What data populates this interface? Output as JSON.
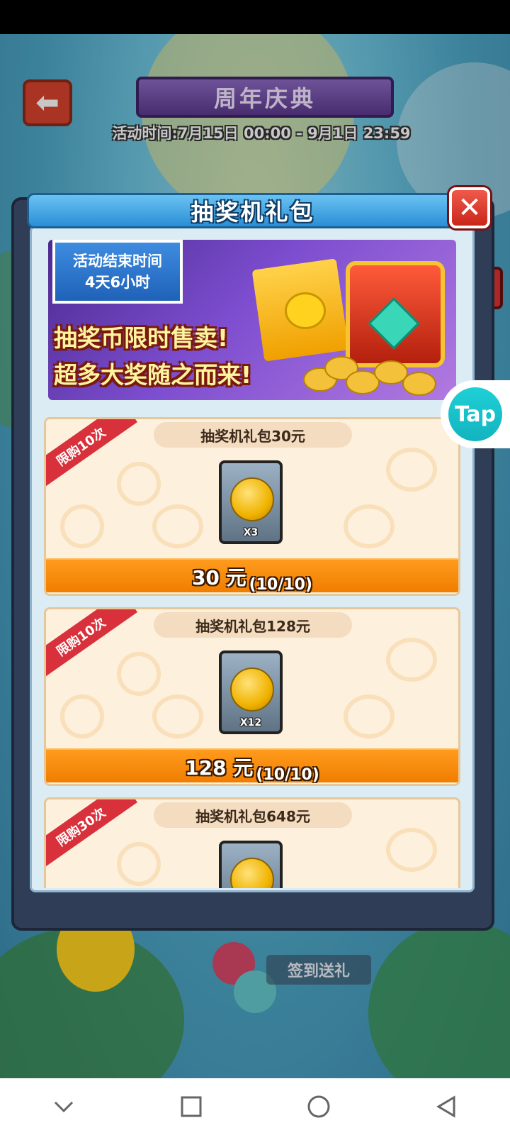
{
  "background": {
    "banner_title": "周年庆典",
    "event_time": "活动时间:7月15日 00:00 - 9月1日 23:59",
    "sign_in_label": "签到送礼",
    "back_icon": "back-arrow-icon"
  },
  "modal": {
    "title": "抽奖机礼包",
    "close_icon": "close-icon"
  },
  "promo": {
    "end_label": "活动结束时间",
    "remaining": "4天6小时",
    "line1": "抽奖币限时售卖!",
    "line2": "超多大奖随之而来!"
  },
  "packages": [
    {
      "limit": "限购10次",
      "title": "抽奖机礼包30元",
      "qty": "X3",
      "price": "30 元",
      "stock": "(10/10)"
    },
    {
      "limit": "限购10次",
      "title": "抽奖机礼包128元",
      "qty": "X12",
      "price": "128 元",
      "stock": "(10/10)"
    },
    {
      "limit": "限购30次",
      "title": "抽奖机礼包648元",
      "qty": "",
      "price": "",
      "stock": ""
    }
  ],
  "overlay": {
    "tap_label": "Tap"
  },
  "navbar": {
    "icons": [
      "chevron-down-icon",
      "recents-square-icon",
      "home-circle-icon",
      "back-triangle-icon"
    ]
  },
  "colors": {
    "header_blue": "#2b8fd6",
    "buy_orange": "#f07d00",
    "ribbon_red": "#d8313b",
    "close_red": "#c9261a"
  }
}
